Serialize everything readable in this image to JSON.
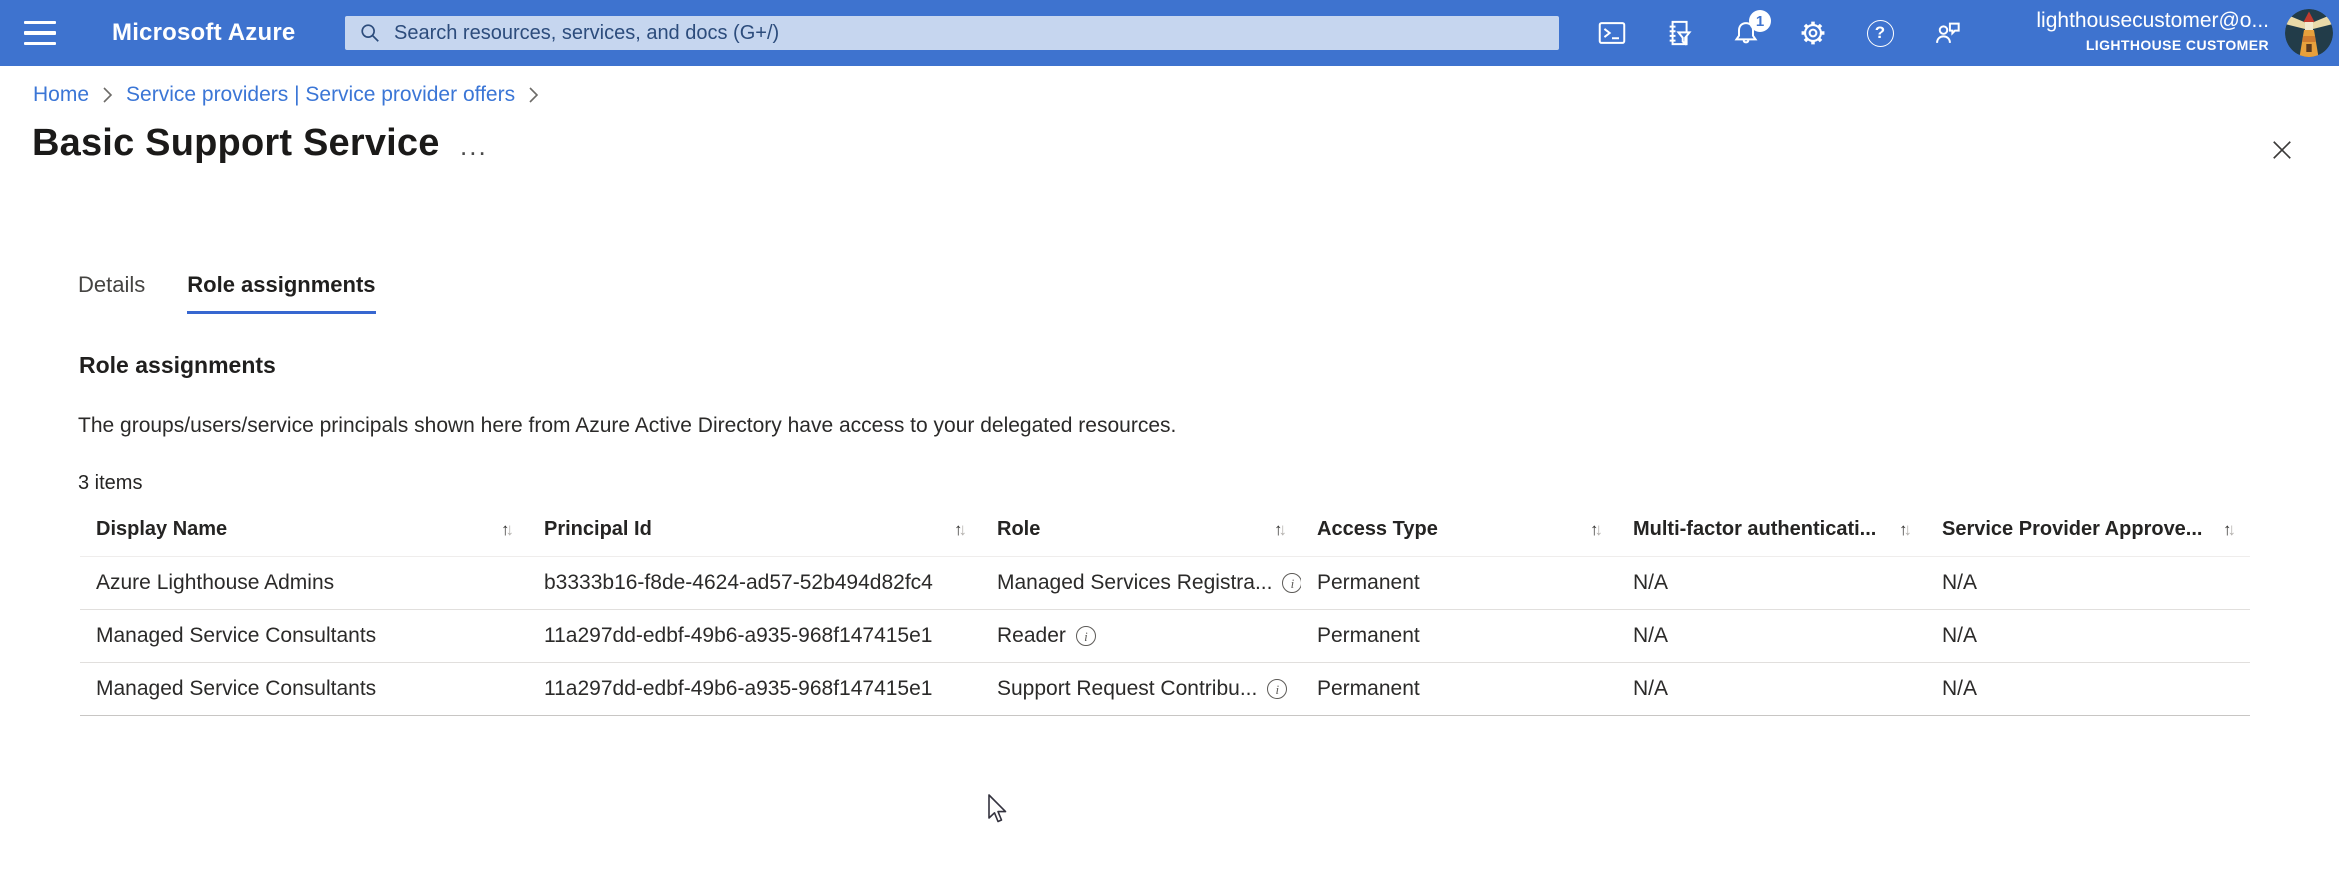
{
  "topbar": {
    "brand": "Microsoft Azure",
    "search_placeholder": "Search resources, services, and docs (G+/)",
    "notification_count": "1",
    "help_glyph": "?",
    "icons": [
      "hamburger-menu",
      "search",
      "cloud-shell",
      "directory-filter",
      "notifications-bell",
      "settings-gear",
      "help",
      "feedback",
      "avatar-lighthouse"
    ],
    "account": {
      "email": "lighthousecustomer@o...",
      "tenant": "LIGHTHOUSE CUSTOMER"
    }
  },
  "breadcrumb": {
    "items": [
      {
        "label": "Home"
      },
      {
        "label": "Service providers | Service provider offers"
      }
    ]
  },
  "page": {
    "title": "Basic Support Service",
    "more_label": "..."
  },
  "tabs": {
    "active_index": 1,
    "items": [
      {
        "label": "Details"
      },
      {
        "label": "Role assignments"
      }
    ]
  },
  "panel": {
    "heading": "Role assignments",
    "description": "The groups/users/service principals shown here from Azure Active Directory have access to your delegated resources.",
    "count": "3 items"
  },
  "table": {
    "columns": [
      {
        "label": "Display Name"
      },
      {
        "label": "Principal Id"
      },
      {
        "label": "Role"
      },
      {
        "label": "Access Type"
      },
      {
        "label": "Multi-factor authenticati..."
      },
      {
        "label": "Service Provider Approve..."
      }
    ],
    "rows": [
      {
        "display_name": "Azure Lighthouse Admins",
        "principal_id": "b3333b16-f8de-4624-ad57-52b494d82fc4",
        "role": "Managed Services Registra...",
        "access_type": "Permanent",
        "mfa": "N/A",
        "service_provider_approval": "N/A"
      },
      {
        "display_name": "Managed Service Consultants",
        "principal_id": "11a297dd-edbf-49b6-a935-968f147415e1",
        "role": "Reader",
        "access_type": "Permanent",
        "mfa": "N/A",
        "service_provider_approval": "N/A"
      },
      {
        "display_name": "Managed Service Consultants",
        "principal_id": "11a297dd-edbf-49b6-a935-968f147415e1",
        "role": "Support Request Contribu...",
        "access_type": "Permanent",
        "mfa": "N/A",
        "service_provider_approval": "N/A"
      }
    ]
  },
  "colors": {
    "topbar_bg": "#3e73cf",
    "search_bg": "#c6d6ef",
    "link_blue": "#3b76d6",
    "active_tab_underline": "#3767d0",
    "text_dark": "#252423",
    "row_divider": "#e1dfdd"
  }
}
